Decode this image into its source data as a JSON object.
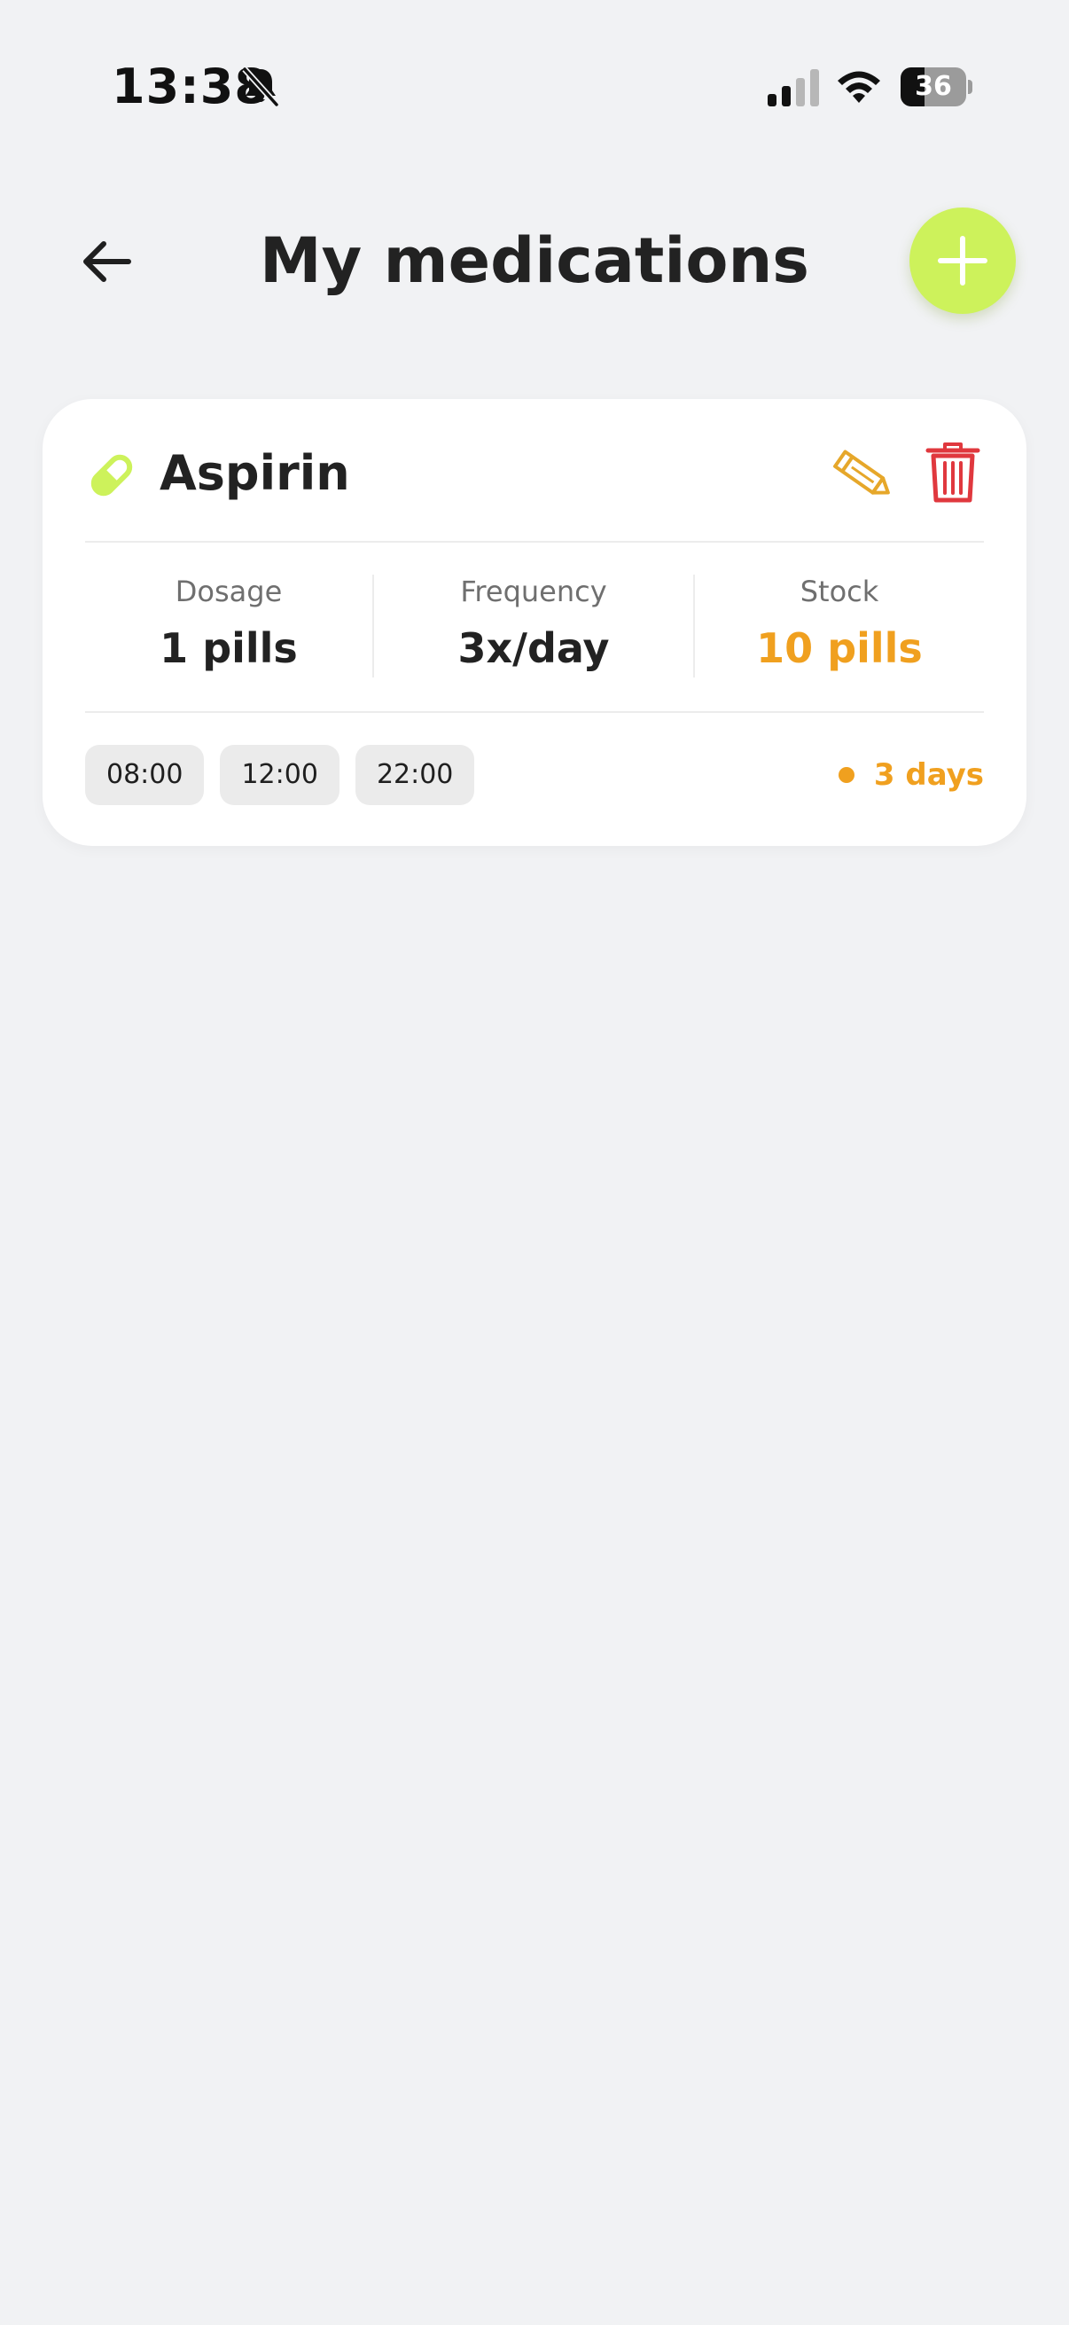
{
  "status_bar": {
    "time": "13:38",
    "battery_level": "36",
    "battery_fraction": 0.36,
    "icons": [
      "bell-slash-icon",
      "cellular-signal-icon",
      "wifi-icon",
      "battery-icon"
    ]
  },
  "header": {
    "title": "My medications",
    "back_icon": "arrow-left-icon",
    "add_icon": "plus-icon"
  },
  "medications": [
    {
      "name": "Aspirin",
      "icon": "pill-icon",
      "stats": [
        {
          "label": "Dosage",
          "value": "1 pills"
        },
        {
          "label": "Frequency",
          "value": "3x/day"
        },
        {
          "label": "Stock",
          "value": "10 pills"
        }
      ],
      "times": [
        "08:00",
        "12:00",
        "22:00"
      ],
      "days_left": "3 days"
    }
  ],
  "colors": {
    "background": "#f1f2f4",
    "accent": "#cdf25b",
    "warning": "#f0a01f",
    "delete": "#e0383e",
    "edit": "#e6a72a",
    "card": "#ffffff"
  }
}
